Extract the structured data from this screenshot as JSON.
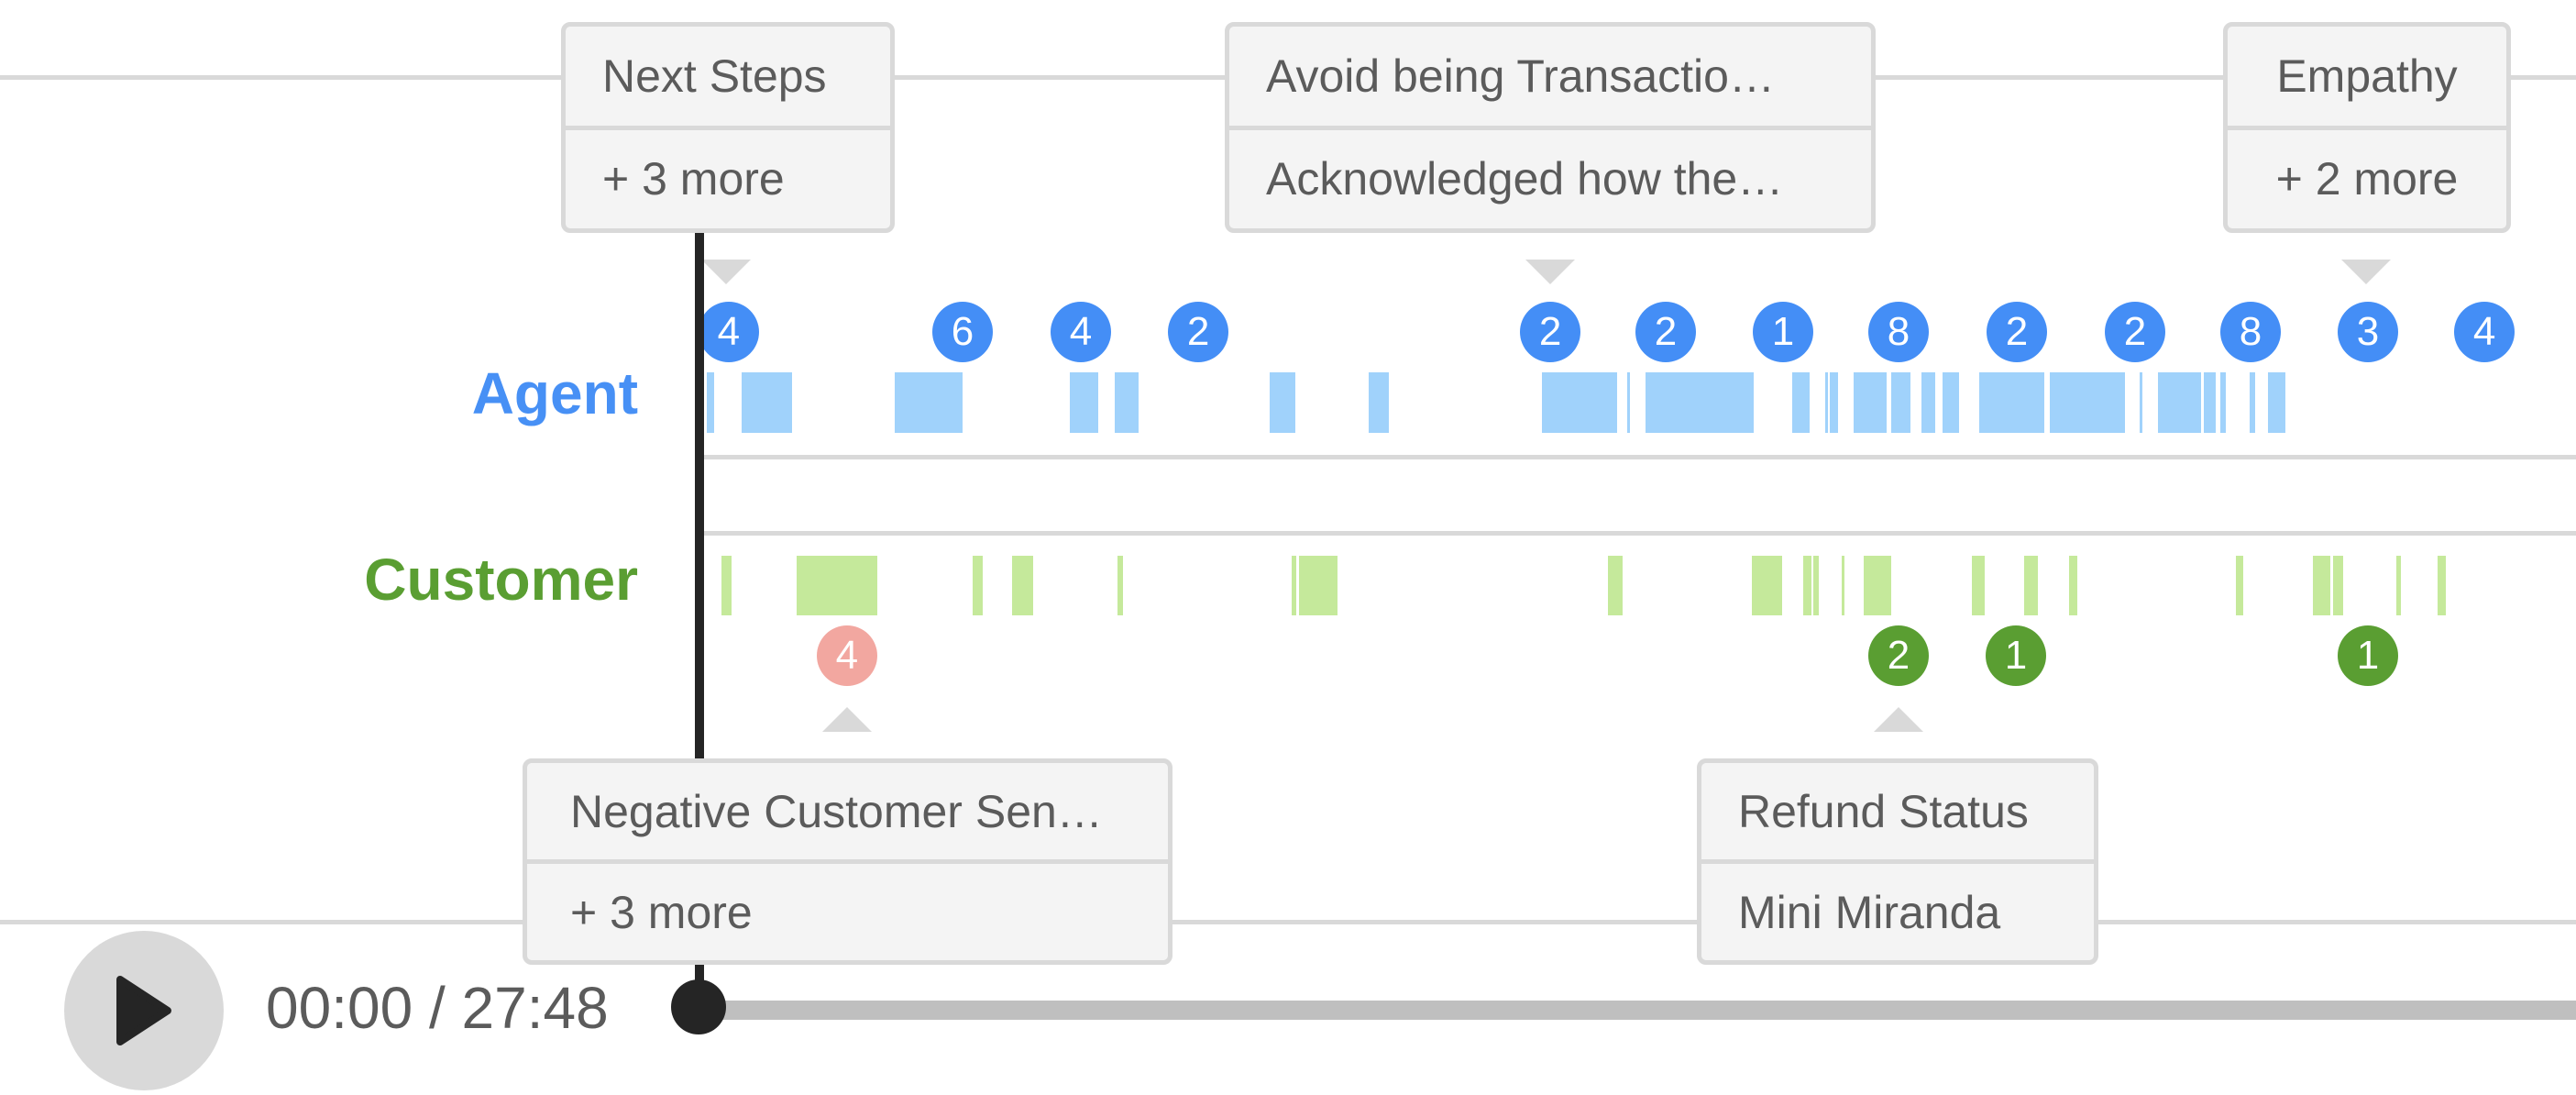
{
  "colors": {
    "agent_label": "#4790f5",
    "agent_segment": "#a0d2fb",
    "agent_badge": "#448ef6",
    "customer_label": "#5a9e32",
    "customer_segment": "#c5e99b",
    "customer_badge": "#5a9e32",
    "negative_badge": "#f2a7a0"
  },
  "speakers": {
    "agent_label": "Agent",
    "customer_label": "Customer"
  },
  "top_tags": [
    {
      "lines": [
        "Next Steps",
        "+ 3 more"
      ],
      "anchor": 0.0078
    },
    {
      "lines": [
        "Avoid being Transactio…",
        "Acknowledged how the…"
      ],
      "anchor": 0.4534
    },
    {
      "lines": [
        "Empathy",
        "+ 2 more"
      ],
      "anchor": 0.8891
    }
  ],
  "bottom_tags": [
    {
      "lines": [
        "Negative Customer Sen…",
        "+ 3 more"
      ],
      "anchor": 0.0786
    },
    {
      "lines": [
        "Refund Status",
        "Mini Miranda"
      ],
      "anchor": 0.6389
    }
  ],
  "agent_badges": [
    {
      "value": "4",
      "pos": 0.0156
    },
    {
      "value": "6",
      "pos": 0.1402
    },
    {
      "value": "4",
      "pos": 0.2032
    },
    {
      "value": "2",
      "pos": 0.2658
    },
    {
      "value": "2",
      "pos": 0.4534
    },
    {
      "value": "2",
      "pos": 0.5149
    },
    {
      "value": "1",
      "pos": 0.5774
    },
    {
      "value": "8",
      "pos": 0.639
    },
    {
      "value": "2",
      "pos": 0.702
    },
    {
      "value": "2",
      "pos": 0.765
    },
    {
      "value": "8",
      "pos": 0.8266
    },
    {
      "value": "3",
      "pos": 0.8891
    },
    {
      "value": "4",
      "pos": 0.9512
    }
  ],
  "customer_badges": [
    {
      "value": "4",
      "pos": 0.0786,
      "sentiment": "negative"
    },
    {
      "value": "2",
      "pos": 0.639,
      "sentiment": "positive"
    },
    {
      "value": "1",
      "pos": 0.7015,
      "sentiment": "positive"
    },
    {
      "value": "1",
      "pos": 0.8891,
      "sentiment": "positive"
    }
  ],
  "agent_segments": [
    [
      0.0039,
      0.0078
    ],
    [
      0.0225,
      0.0493
    ],
    [
      0.104,
      0.1402
    ],
    [
      0.1973,
      0.2125
    ],
    [
      0.2213,
      0.234
    ],
    [
      0.3038,
      0.3175
    ],
    [
      0.3566,
      0.3673
    ],
    [
      0.449,
      0.489
    ],
    [
      0.4944,
      0.4958
    ],
    [
      0.5041,
      0.5617
    ],
    [
      0.5822,
      0.5915
    ],
    [
      0.5998,
      0.6008
    ],
    [
      0.6023,
      0.6067
    ],
    [
      0.6149,
      0.6326
    ],
    [
      0.635,
      0.6453
    ],
    [
      0.6511,
      0.6585
    ],
    [
      0.6624,
      0.6712
    ],
    [
      0.6819,
      0.7166
    ],
    [
      0.7195,
      0.7596
    ],
    [
      0.7675,
      0.7689
    ],
    [
      0.7772,
      0.8001
    ],
    [
      0.8016,
      0.8081
    ],
    [
      0.8105,
      0.8134
    ],
    [
      0.8261,
      0.829
    ],
    [
      0.8358,
      0.8451
    ]
  ],
  "customer_segments": [
    [
      0.0117,
      0.0171
    ],
    [
      0.0518,
      0.0947
    ],
    [
      0.1456,
      0.151
    ],
    [
      0.1666,
      0.1778
    ],
    [
      0.2227,
      0.2257
    ],
    [
      0.3156,
      0.3181
    ],
    [
      0.3195,
      0.34
    ],
    [
      0.4841,
      0.4919
    ],
    [
      0.5608,
      0.5769
    ],
    [
      0.5882,
      0.5926
    ],
    [
      0.5936,
      0.5965
    ],
    [
      0.6087,
      0.6102
    ],
    [
      0.6204,
      0.6351
    ],
    [
      0.6781,
      0.6849
    ],
    [
      0.7059,
      0.7132
    ],
    [
      0.7298,
      0.7342
    ],
    [
      0.8188,
      0.8227
    ],
    [
      0.8598,
      0.8691
    ],
    [
      0.8706,
      0.8759
    ],
    [
      0.9042,
      0.9067
    ],
    [
      0.9262,
      0.9306
    ]
  ],
  "player": {
    "current_time": "00:00",
    "duration": "27:48",
    "time_display": "00:00 / 27:48",
    "progress": 0
  }
}
